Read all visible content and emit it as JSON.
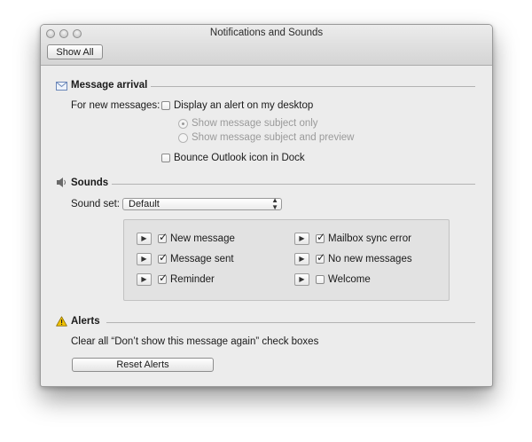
{
  "window": {
    "title": "Notifications and Sounds"
  },
  "toolbar": {
    "show_all_label": "Show All"
  },
  "message_arrival": {
    "heading": "Message arrival",
    "for_new_label": "For new messages:",
    "display_alert": {
      "label": "Display an alert on my desktop",
      "checked": false
    },
    "radio_subject_only": {
      "label": "Show message subject only",
      "selected": true,
      "enabled": false
    },
    "radio_subject_preview": {
      "label": "Show message subject and preview",
      "selected": false,
      "enabled": false
    },
    "bounce_icon": {
      "label": "Bounce Outlook icon in Dock",
      "checked": false
    }
  },
  "sounds": {
    "heading": "Sounds",
    "sound_set_label": "Sound set:",
    "sound_set_value": "Default",
    "items": [
      {
        "label": "New message",
        "checked": true
      },
      {
        "label": "Message sent",
        "checked": true
      },
      {
        "label": "Reminder",
        "checked": true
      },
      {
        "label": "Mailbox sync error",
        "checked": true
      },
      {
        "label": "No new messages",
        "checked": true
      },
      {
        "label": "Welcome",
        "checked": false
      }
    ]
  },
  "alerts": {
    "heading": "Alerts",
    "description": "Clear all “Don’t show this message again” check boxes",
    "reset_label": "Reset Alerts"
  },
  "icons": {
    "message_arrival": "envelope-icon",
    "sounds": "speaker-icon",
    "alerts": "warning-icon",
    "play": "play-icon",
    "check": "checkmark-icon"
  }
}
